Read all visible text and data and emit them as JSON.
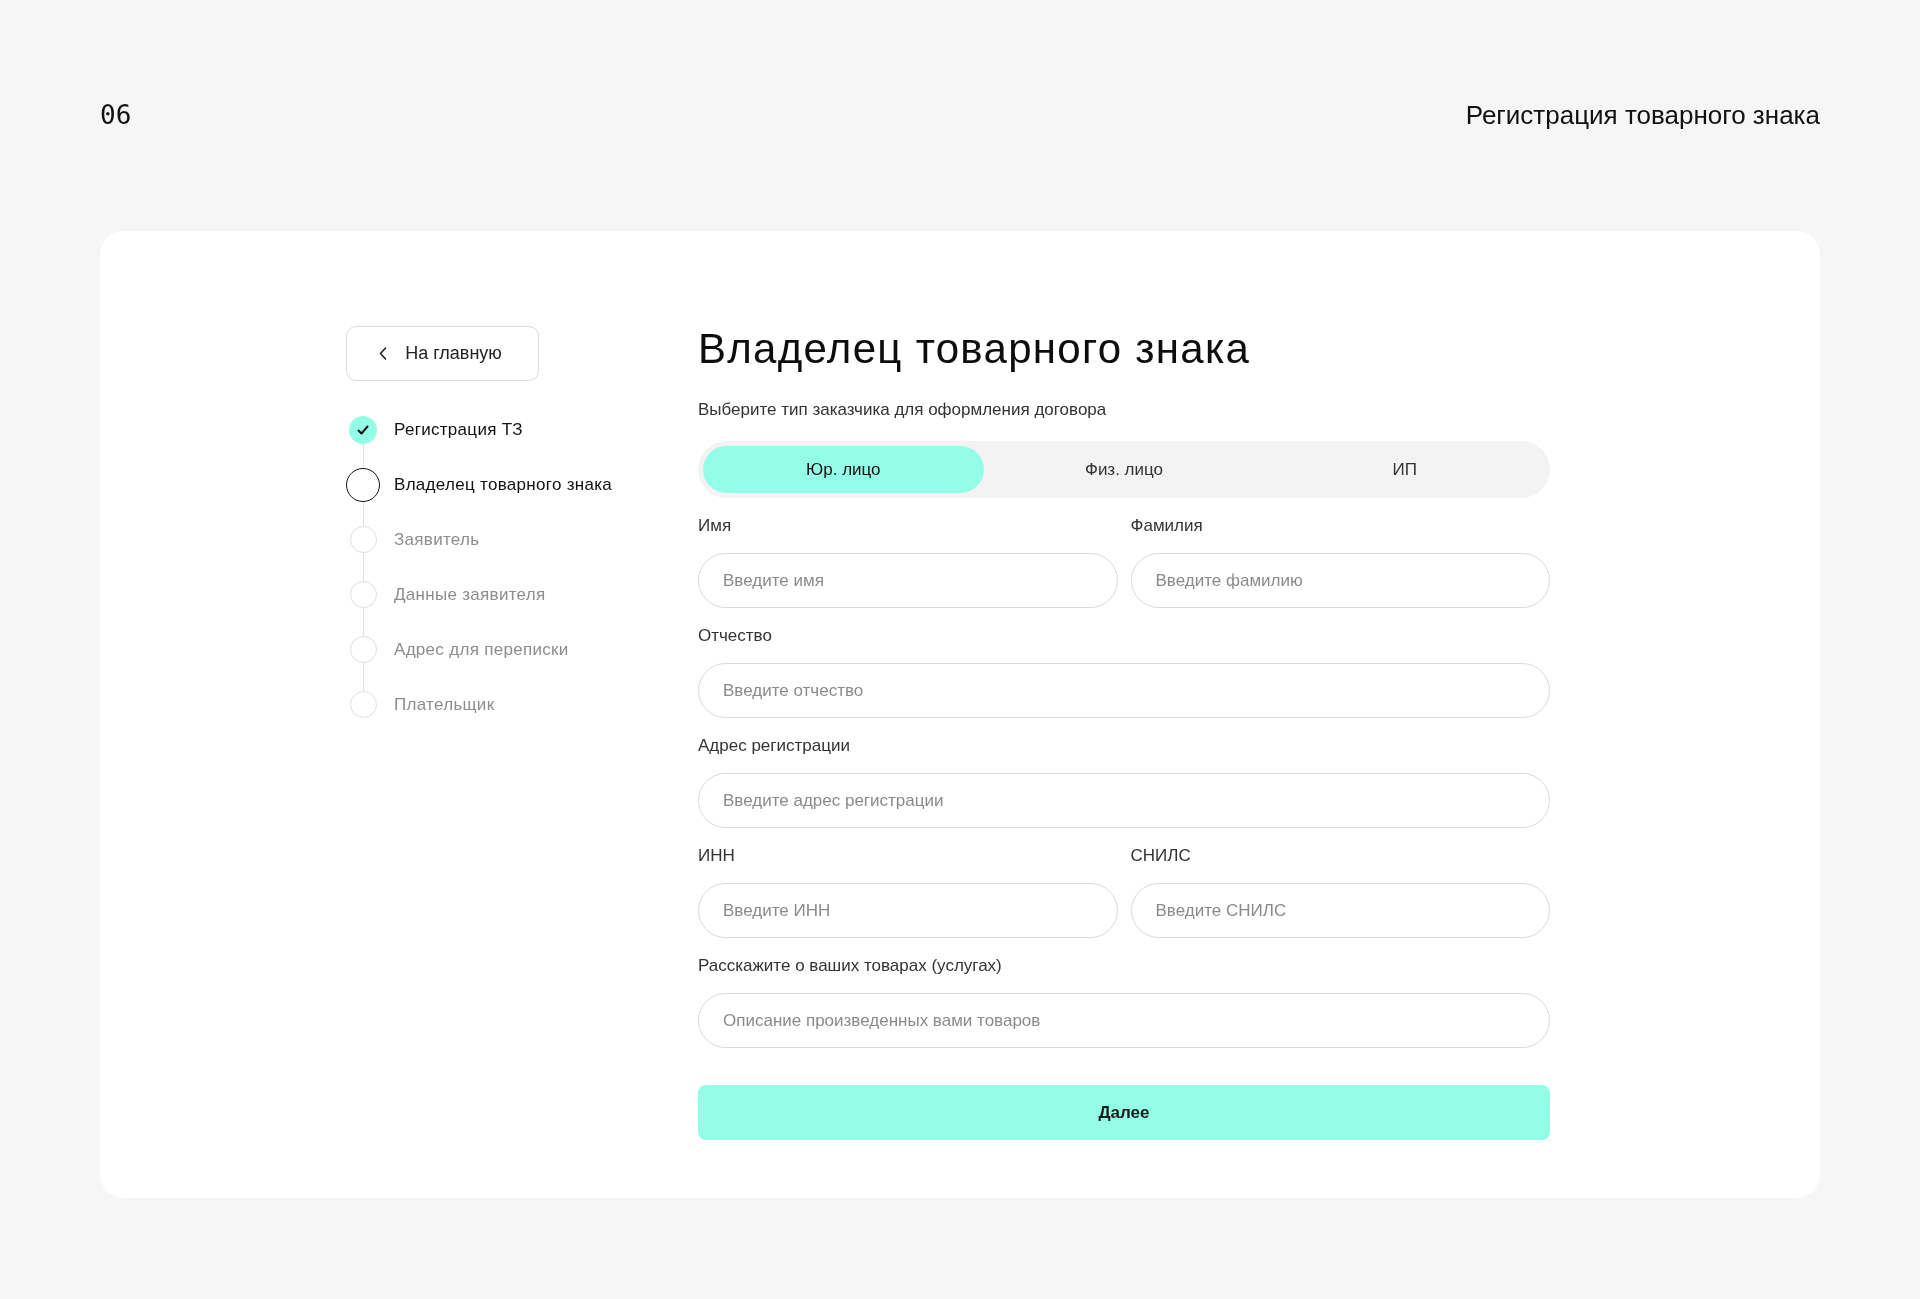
{
  "page_number": "06",
  "page_title": "Регистрация товарного знака",
  "back_button": {
    "label": "На главную"
  },
  "steps": [
    {
      "label": "Регистрация ТЗ",
      "completed": true,
      "selected": false
    },
    {
      "label": "Владелец товарного знака",
      "completed": false,
      "selected": true
    },
    {
      "label": "Заявитель",
      "completed": false,
      "selected": false
    },
    {
      "label": "Данные заявителя",
      "completed": false,
      "selected": false
    },
    {
      "label": "Адрес для переписки",
      "completed": false,
      "selected": false
    },
    {
      "label": "Плательщик",
      "completed": false,
      "selected": false
    }
  ],
  "form": {
    "title": "Владелец товарного знака",
    "subtitle": "Выберите тип заказчика для оформления договора",
    "customer_types": [
      {
        "label": "Юр. лицо",
        "selected": true
      },
      {
        "label": "Физ. лицо",
        "selected": false
      },
      {
        "label": "ИП",
        "selected": false
      }
    ],
    "rows": [
      {
        "fields": [
          {
            "label": "Имя",
            "placeholder": "Введите имя"
          },
          {
            "label": "Фамилия",
            "placeholder": "Введите фамилию"
          }
        ]
      },
      {
        "fields": [
          {
            "label": "Отчество",
            "placeholder": "Введите отчество"
          }
        ]
      },
      {
        "fields": [
          {
            "label": "Адрес регистрации",
            "placeholder": "Введите адрес регистрации"
          }
        ]
      },
      {
        "fields": [
          {
            "label": "ИНН",
            "placeholder": "Введите ИНН"
          },
          {
            "label": "СНИЛС",
            "placeholder": "Введите СНИЛС"
          }
        ]
      },
      {
        "fields": [
          {
            "label": "Расскажите о ваших товарах (услугах)",
            "placeholder": "Описание произведенных вами товаров"
          }
        ]
      }
    ],
    "submit": {
      "label": "Далее"
    }
  }
}
